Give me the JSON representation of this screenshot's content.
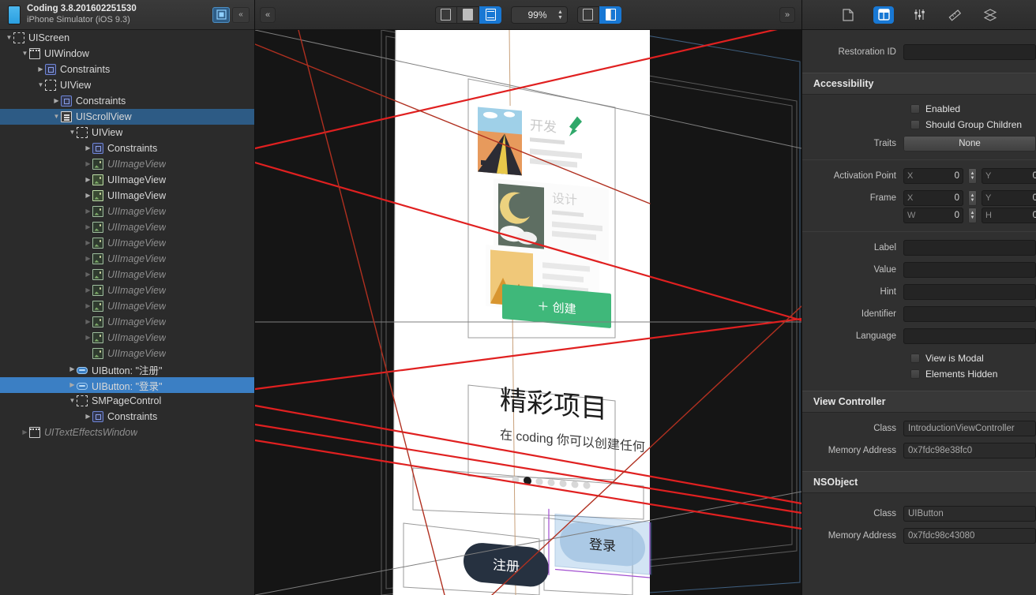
{
  "navigator": {
    "title": "Coding 3.8.201602251530",
    "subtitle": "iPhone Simulator (iOS 9.3)",
    "sim_icon": "iphone-simulator-icon",
    "header_buttons": [
      {
        "name": "view-hierarchy-toggle-button",
        "icon": "constraint-grid-icon",
        "active": true
      },
      {
        "name": "collapse-navigator-button",
        "icon": "chevron-double-left-icon",
        "active": false
      }
    ],
    "tree": [
      {
        "label": "UIScreen",
        "depth": 0,
        "icon": "screen-icon",
        "twist": "open",
        "dim": false,
        "selected": false
      },
      {
        "label": "UIWindow",
        "depth": 1,
        "icon": "window-icon",
        "twist": "open",
        "dim": false,
        "selected": false
      },
      {
        "label": "Constraints",
        "depth": 2,
        "icon": "constraint-icon",
        "twist": "closed",
        "dim": false,
        "selected": false
      },
      {
        "label": "UIView",
        "depth": 2,
        "icon": "view-icon",
        "twist": "open",
        "dim": false,
        "selected": false
      },
      {
        "label": "Constraints",
        "depth": 3,
        "icon": "constraint-icon",
        "twist": "closed",
        "dim": false,
        "selected": false
      },
      {
        "label": "UIScrollView",
        "depth": 3,
        "icon": "scrollview-icon",
        "twist": "open",
        "dim": false,
        "selected": true,
        "strong": false
      },
      {
        "label": "UIView",
        "depth": 4,
        "icon": "view-icon",
        "twist": "open",
        "dim": false,
        "selected": false
      },
      {
        "label": "Constraints",
        "depth": 5,
        "icon": "constraint-icon",
        "twist": "closed",
        "dim": false,
        "selected": false
      },
      {
        "label": "UIImageView",
        "depth": 5,
        "icon": "image-icon",
        "twist": "closed",
        "dim": true,
        "selected": false
      },
      {
        "label": "UIImageView",
        "depth": 5,
        "icon": "image-icon-on",
        "twist": "closed",
        "dim": false,
        "selected": false
      },
      {
        "label": "UIImageView",
        "depth": 5,
        "icon": "image-icon-on",
        "twist": "closed",
        "dim": false,
        "selected": false
      },
      {
        "label": "UIImageView",
        "depth": 5,
        "icon": "image-icon",
        "twist": "closed",
        "dim": true,
        "selected": false
      },
      {
        "label": "UIImageView",
        "depth": 5,
        "icon": "image-icon",
        "twist": "closed",
        "dim": true,
        "selected": false
      },
      {
        "label": "UIImageView",
        "depth": 5,
        "icon": "image-icon",
        "twist": "closed",
        "dim": true,
        "selected": false
      },
      {
        "label": "UIImageView",
        "depth": 5,
        "icon": "image-icon",
        "twist": "closed",
        "dim": true,
        "selected": false
      },
      {
        "label": "UIImageView",
        "depth": 5,
        "icon": "image-icon",
        "twist": "closed",
        "dim": true,
        "selected": false
      },
      {
        "label": "UIImageView",
        "depth": 5,
        "icon": "image-icon",
        "twist": "closed",
        "dim": true,
        "selected": false
      },
      {
        "label": "UIImageView",
        "depth": 5,
        "icon": "image-icon",
        "twist": "closed",
        "dim": true,
        "selected": false
      },
      {
        "label": "UIImageView",
        "depth": 5,
        "icon": "image-icon",
        "twist": "closed",
        "dim": true,
        "selected": false
      },
      {
        "label": "UIImageView",
        "depth": 5,
        "icon": "image-icon",
        "twist": "closed",
        "dim": true,
        "selected": false
      },
      {
        "label": "UIImageView",
        "depth": 5,
        "icon": "image-icon",
        "twist": "none",
        "dim": true,
        "selected": false
      },
      {
        "label": "UIButton: \"注册\"",
        "depth": 4,
        "icon": "button-icon",
        "twist": "closed",
        "dim": false,
        "selected": false
      },
      {
        "label": "UIButton: \"登录\"",
        "depth": 4,
        "icon": "button-icon",
        "twist": "closed",
        "dim": false,
        "selected": true,
        "strong": true
      },
      {
        "label": "SMPageControl",
        "depth": 4,
        "icon": "pagecontrol-icon",
        "twist": "open",
        "dim": false,
        "selected": false
      },
      {
        "label": "Constraints",
        "depth": 5,
        "icon": "constraint-icon",
        "twist": "closed",
        "dim": false,
        "selected": false
      },
      {
        "label": "UITextEffectsWindow",
        "depth": 1,
        "icon": "window-icon",
        "twist": "closed",
        "dim": true,
        "selected": false
      }
    ]
  },
  "canvas": {
    "collapse_button": "«",
    "expand_button": "»",
    "zoom_level": "99%",
    "view_mode_buttons": [
      {
        "name": "show-clipped-content-button",
        "icon": "clipped-content-icon",
        "active": false
      },
      {
        "name": "show-constraints-button",
        "icon": "constraints-view-icon",
        "active": false
      },
      {
        "name": "show-view-frames-button",
        "icon": "view-frames-icon",
        "active": true
      }
    ],
    "right_buttons": [
      {
        "name": "adjust-view-mode-button",
        "icon": "single-view-icon",
        "active": false
      },
      {
        "name": "show-hierarchy-spacing-button",
        "icon": "split-view-icon",
        "active": true
      }
    ],
    "device_preview": {
      "cards": [
        {
          "title": "开发",
          "badge": "pin-icon",
          "image": "desert-road-illustration"
        },
        {
          "title": "设计",
          "image": "moon-clouds-illustration"
        },
        {
          "title": "",
          "image": "mountain-illustration"
        }
      ],
      "create_button": "＋ 创建",
      "create_button_color": "#3fb87a",
      "heading": "精彩项目",
      "subheading": "在 coding 你可以创建任何",
      "page_dots_total": 7,
      "page_dots_active_index": 1,
      "buttons": [
        {
          "label": "注册",
          "style": "dark",
          "name": "register-button"
        },
        {
          "label": "登录",
          "style": "selected",
          "name": "login-button"
        }
      ]
    }
  },
  "inspector": {
    "tabs": [
      {
        "name": "file-inspector-tab",
        "icon": "document-icon",
        "active": false
      },
      {
        "name": "object-inspector-tab",
        "icon": "object-panel-icon",
        "active": true
      },
      {
        "name": "attributes-inspector-tab",
        "icon": "sliders-icon",
        "active": false
      },
      {
        "name": "size-inspector-tab",
        "icon": "ruler-icon",
        "active": false
      },
      {
        "name": "connections-inspector-tab",
        "icon": "layers-icon",
        "active": false
      }
    ],
    "restoration": {
      "label": "Restoration ID",
      "value": ""
    },
    "accessibility": {
      "title": "Accessibility",
      "enabled_label": "Enabled",
      "enabled_checked": false,
      "group_children_label": "Should Group Children",
      "group_children_checked": false,
      "traits_label": "Traits",
      "traits_value": "None",
      "activation_point_label": "Activation Point",
      "activation_point": {
        "x_key": "X",
        "x": "0",
        "y_key": "Y",
        "y": "0"
      },
      "frame_label": "Frame",
      "frame": {
        "x_key": "X",
        "x": "0",
        "y_key": "Y",
        "y": "0",
        "w_key": "W",
        "w": "0",
        "h_key": "H",
        "h": "0"
      },
      "fields": [
        {
          "label": "Label",
          "value": ""
        },
        {
          "label": "Value",
          "value": ""
        },
        {
          "label": "Hint",
          "value": ""
        },
        {
          "label": "Identifier",
          "value": ""
        },
        {
          "label": "Language",
          "value": ""
        }
      ],
      "modal_label": "View is Modal",
      "modal_checked": false,
      "hidden_label": "Elements Hidden",
      "hidden_checked": false
    },
    "view_controller": {
      "title": "View Controller",
      "class_label": "Class",
      "class_value": "IntroductionViewController",
      "memory_label": "Memory Address",
      "memory_value": "0x7fdc98e38fc0"
    },
    "nsobject": {
      "title": "NSObject",
      "class_label": "Class",
      "class_value": "UIButton",
      "memory_label": "Memory Address",
      "memory_value": "0x7fdc98c43080"
    }
  }
}
